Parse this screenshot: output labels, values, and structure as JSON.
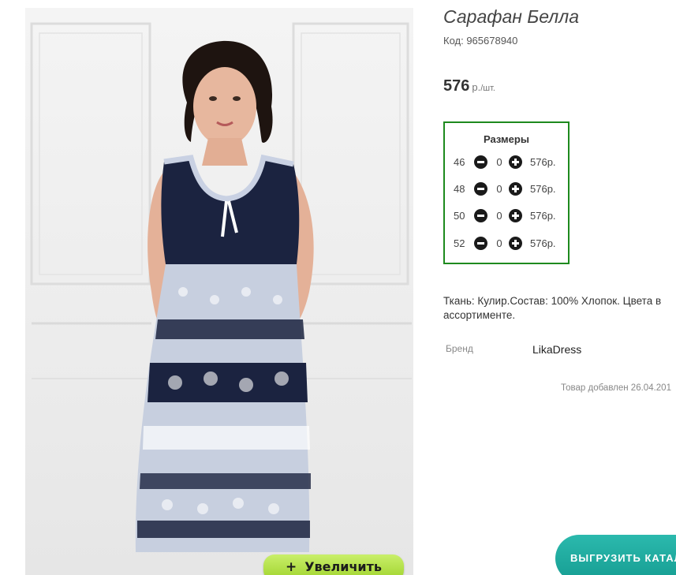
{
  "product": {
    "title": "Сарафан Белла",
    "code": "Код: 965678940",
    "price_value": "576",
    "price_currency": "р.",
    "price_unit": "/шт.",
    "image_alt": "Сарафан Белла — фото модели"
  },
  "zoom": {
    "plus": "+",
    "label": "Увеличить"
  },
  "sizes": {
    "title": "Размеры",
    "rows": [
      {
        "size": "46",
        "qty": "0",
        "price": "576р."
      },
      {
        "size": "48",
        "qty": "0",
        "price": "576р."
      },
      {
        "size": "50",
        "qty": "0",
        "price": "576р."
      },
      {
        "size": "52",
        "qty": "0",
        "price": "576р."
      }
    ]
  },
  "description": "Ткань: Кулир.Состав: 100% Хлопок. Цвета в ассортименте.",
  "brand": {
    "label": "Бренд",
    "value": "LikaDress"
  },
  "added_text": "Товар добавлен 26.04.201",
  "export_button": "ВЫГРУЗИТЬ КАТАЛ",
  "colors": {
    "sizes_border": "#1e8a1e",
    "zoom_button": "#9ed22b",
    "export_button": "#169d92",
    "dress_navy": "#1b2340"
  },
  "icons": [
    "minus-circle-icon",
    "plus-circle-icon"
  ]
}
